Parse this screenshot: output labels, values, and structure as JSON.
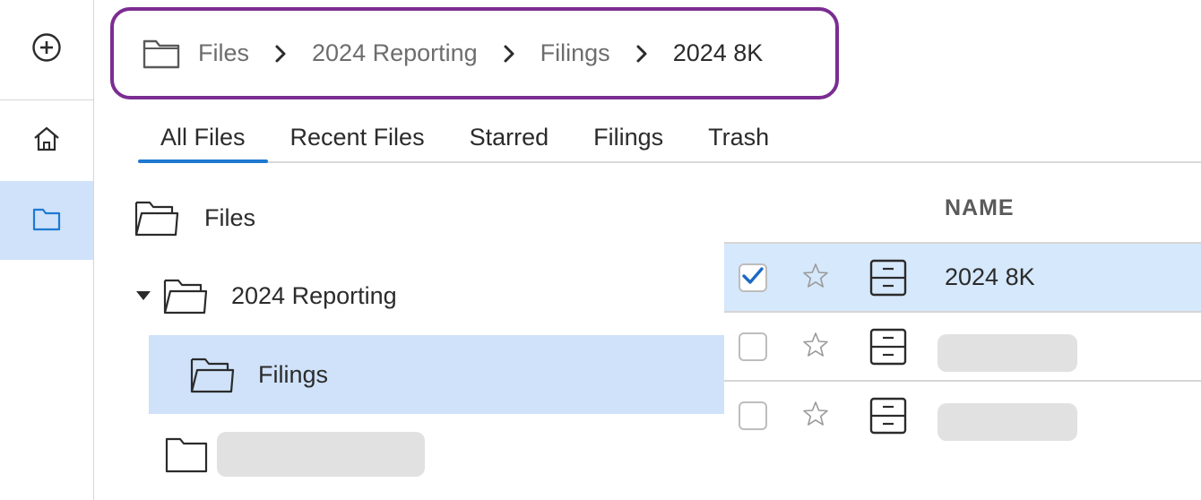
{
  "rail": {
    "items": [
      {
        "name": "add",
        "icon": "plus-circle-icon"
      },
      {
        "name": "home",
        "icon": "home-icon"
      },
      {
        "name": "files",
        "icon": "folder-icon",
        "active": true
      }
    ]
  },
  "breadcrumb": {
    "icon": "folder-icon",
    "items": [
      "Files",
      "2024 Reporting",
      "Filings",
      "2024 8K"
    ]
  },
  "tabs": [
    "All Files",
    "Recent Files",
    "Starred",
    "Filings",
    "Trash"
  ],
  "active_tab": "All Files",
  "tree": {
    "root": "Files",
    "reporting": "2024 Reporting",
    "filings": "Filings"
  },
  "table": {
    "header_name": "NAME",
    "rows": [
      {
        "name": "2024 8K",
        "checked": true,
        "starred": false
      },
      {
        "name": "",
        "checked": false,
        "starred": false
      },
      {
        "name": "",
        "checked": false,
        "starred": false
      }
    ]
  },
  "colors": {
    "accent": "#1f79d1",
    "breadcrumb_border": "#7b2d91",
    "selection": "#cfe2fa"
  }
}
